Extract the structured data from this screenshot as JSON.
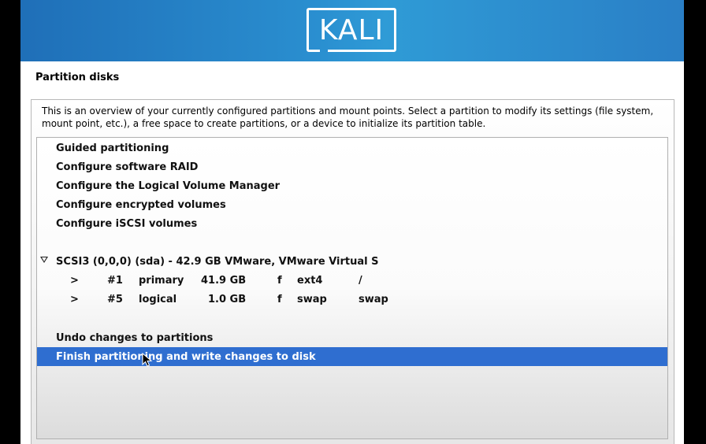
{
  "header": {
    "logo_text": "KALI"
  },
  "page": {
    "title": "Partition disks",
    "help_text": "This is an overview of your currently configured partitions and mount points. Select a partition to modify its settings (file system, mount point, etc.), a free space to create partitions, or a device to initialize its partition table."
  },
  "options": [
    {
      "label": "Guided partitioning"
    },
    {
      "label": "Configure software RAID"
    },
    {
      "label": "Configure the Logical Volume Manager"
    },
    {
      "label": "Configure encrypted volumes"
    },
    {
      "label": "Configure iSCSI volumes"
    }
  ],
  "disk": {
    "label": "SCSI3 (0,0,0) (sda) - 42.9 GB VMware, VMware Virtual S",
    "expanded": true,
    "partitions": [
      {
        "arrow": ">",
        "number": "#1",
        "type": "primary",
        "size": "41.9 GB",
        "flag": "f",
        "fs": "ext4",
        "mount": "/"
      },
      {
        "arrow": ">",
        "number": "#5",
        "type": "logical",
        "size": "1.0 GB",
        "flag": "f",
        "fs": "swap",
        "mount": "swap"
      }
    ]
  },
  "actions": [
    {
      "label": "Undo changes to partitions",
      "selected": false
    },
    {
      "label": "Finish partitioning and write changes to disk",
      "selected": true
    }
  ],
  "colors": {
    "banner": "#2a8fd0",
    "selection": "#2f6ed0"
  }
}
